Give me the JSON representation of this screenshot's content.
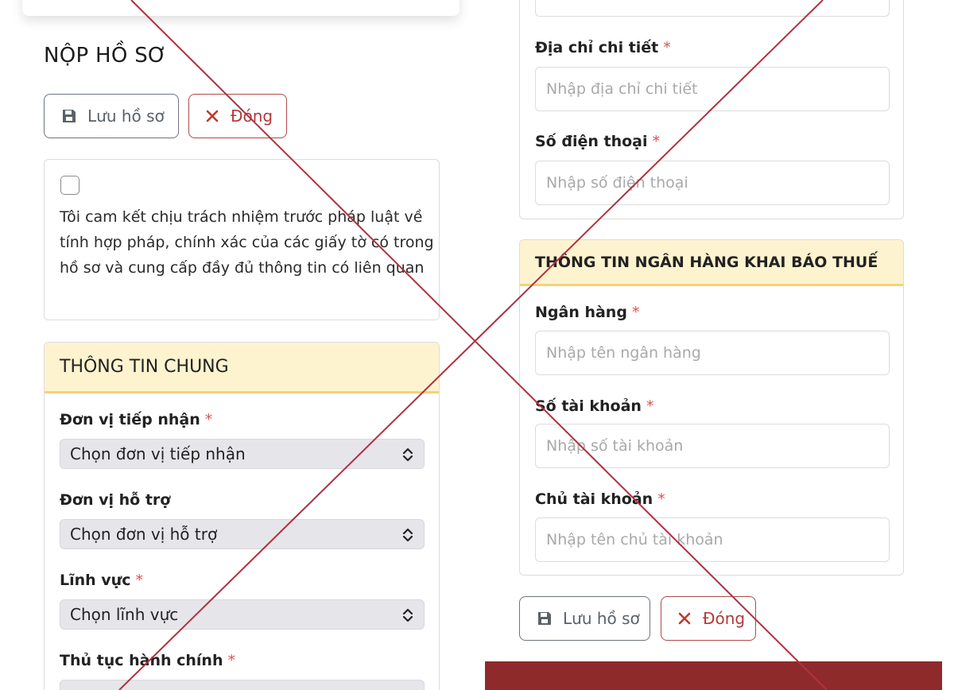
{
  "title": "NỘP HỒ SƠ",
  "buttons": {
    "save": "Lưu hồ sơ",
    "close": "Đóng"
  },
  "commitment": "Tôi cam kết chịu trách nhiệm trước pháp luật về tính hợp pháp, chính xác của các giấy tờ có trong hồ sơ và cung cấp đầy đủ thông tin có liên quan",
  "general": {
    "header": "THÔNG TIN CHUNG",
    "fields": [
      {
        "label": "Đơn vị tiếp nhận",
        "required": "*",
        "placeholder": "Chọn đơn vị tiếp nhận"
      },
      {
        "label": "Đơn vị hỗ trợ",
        "placeholder": "Chọn đơn vị hỗ trợ"
      },
      {
        "label": "Lĩnh vực",
        "required": "*",
        "placeholder": "Chọn lĩnh vực"
      },
      {
        "label": "Thủ tục hành chính",
        "required": "*"
      }
    ]
  },
  "contact": {
    "fields": [
      {
        "label": "Địa chỉ chi tiết",
        "required": "*",
        "placeholder": "Nhập địa chỉ chi tiết"
      },
      {
        "label": "Số điện thoại",
        "required": "*",
        "placeholder": "Nhập số điện thoại"
      }
    ]
  },
  "bank": {
    "header": "THÔNG TIN NGÂN HÀNG KHAI BÁO THUẾ",
    "fields": [
      {
        "label": "Ngân hàng",
        "required": "*",
        "placeholder": "Nhập tên ngân hàng"
      },
      {
        "label": "Số tài khoản",
        "required": "*",
        "placeholder": "Nhập số tài khoản"
      },
      {
        "label": "Chủ tài khoản",
        "required": "*",
        "placeholder": "Nhập tên chủ tài khoản"
      }
    ]
  },
  "colors": {
    "overlay_x": "#b03040",
    "header_bg": "#fdf3cf",
    "alert_bg": "#8e2a2a"
  }
}
